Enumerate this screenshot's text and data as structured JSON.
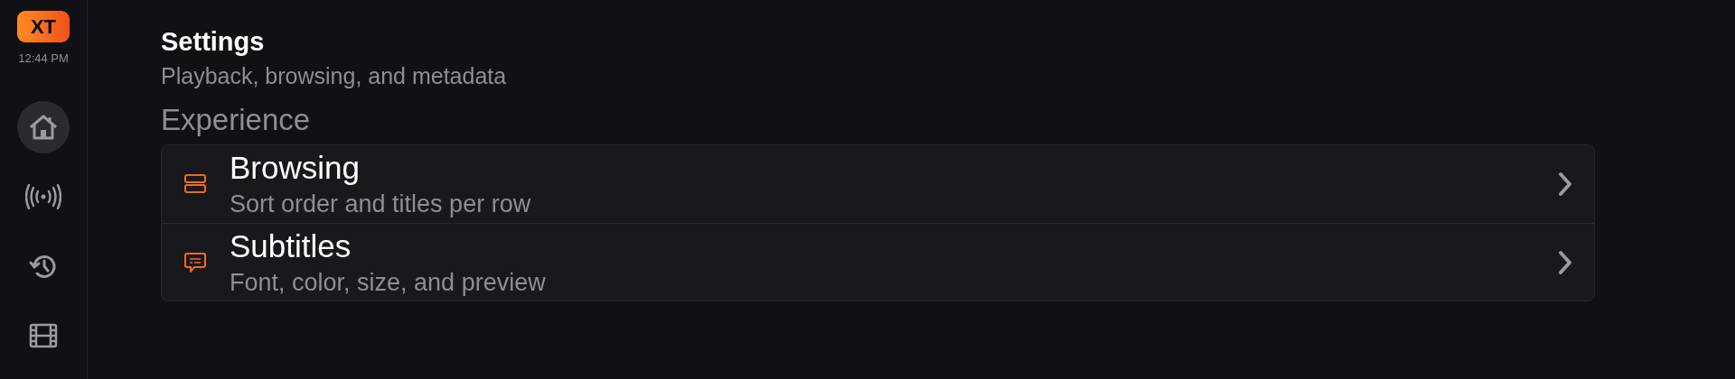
{
  "sidebar": {
    "logo": "XT",
    "time": "12:44 PM",
    "items": [
      {
        "kind": "home",
        "selected": true
      },
      {
        "kind": "live",
        "selected": false
      },
      {
        "kind": "history",
        "selected": false
      },
      {
        "kind": "movies",
        "selected": false
      }
    ]
  },
  "header": {
    "title": "Settings",
    "subtitle": "Playback, browsing, and metadata"
  },
  "sections": [
    {
      "title": "Experience",
      "rows": [
        {
          "kind": "browsing",
          "title": "Browsing",
          "subtitle": "Sort order and titles per row"
        },
        {
          "kind": "subtitles",
          "title": "Subtitles",
          "subtitle": "Font, color, size, and preview"
        }
      ]
    }
  ]
}
